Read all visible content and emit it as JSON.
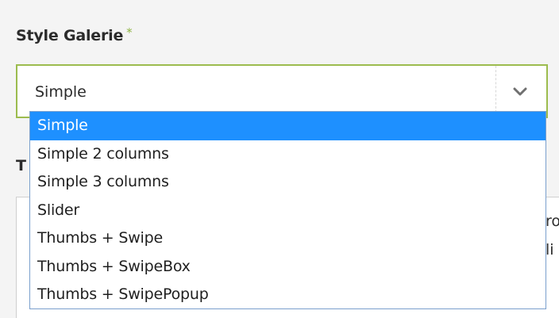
{
  "form": {
    "style_label": "Style Galerie",
    "required_marker": "*",
    "selected_value": "Simple",
    "chevron_icon": "chevron-down-icon",
    "accent_color": "#9cbc4e",
    "next_label_partial": "T",
    "behind_text_line1": "ro",
    "behind_text_line2": "li"
  },
  "dropdown": {
    "highlight_color": "#1e90ff",
    "options": [
      {
        "label": "Simple",
        "selected": true
      },
      {
        "label": "Simple 2 columns",
        "selected": false
      },
      {
        "label": "Simple 3 columns",
        "selected": false
      },
      {
        "label": "Slider",
        "selected": false
      },
      {
        "label": "Thumbs + Swipe",
        "selected": false
      },
      {
        "label": "Thumbs + SwipeBox",
        "selected": false
      },
      {
        "label": "Thumbs + SwipePopup",
        "selected": false
      }
    ]
  }
}
